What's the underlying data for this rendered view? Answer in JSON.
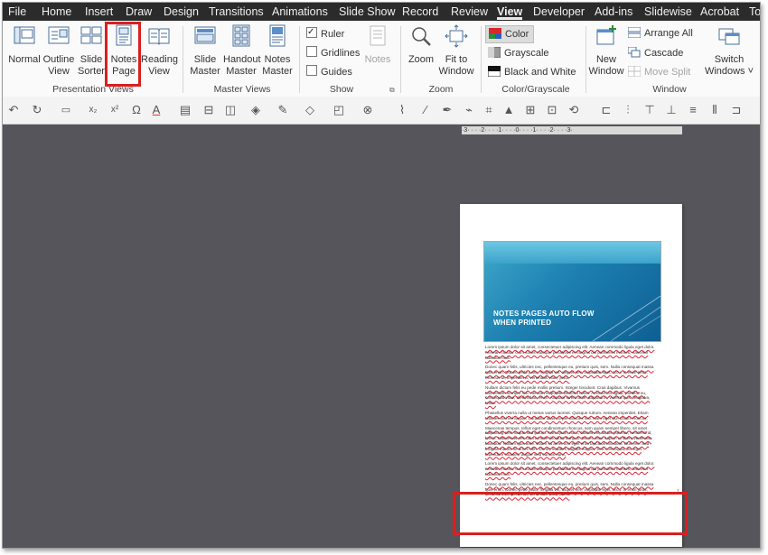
{
  "menu_tabs": [
    "File",
    "Home",
    "Insert",
    "Draw",
    "Design",
    "Transitions",
    "Animations",
    "Slide Show",
    "Record",
    "Review",
    "View",
    "Developer",
    "Add-ins",
    "Slidewise",
    "Acrobat",
    "To"
  ],
  "active_tab": "View",
  "ribbon": {
    "presentation_views": {
      "label": "Presentation Views",
      "buttons": [
        {
          "line1": "Normal",
          "line2": ""
        },
        {
          "line1": "Outline",
          "line2": "View"
        },
        {
          "line1": "Slide",
          "line2": "Sorter"
        },
        {
          "line1": "Notes",
          "line2": "Page"
        },
        {
          "line1": "Reading",
          "line2": "View"
        }
      ]
    },
    "master_views": {
      "label": "Master Views",
      "buttons": [
        {
          "line1": "Slide",
          "line2": "Master"
        },
        {
          "line1": "Handout",
          "line2": "Master"
        },
        {
          "line1": "Notes",
          "line2": "Master"
        }
      ]
    },
    "show": {
      "label": "Show",
      "ruler": "Ruler",
      "gridlines": "Gridlines",
      "guides": "Guides",
      "notes": "Notes"
    },
    "zoom": {
      "label": "Zoom",
      "zoom": "Zoom",
      "fit_line1": "Fit to",
      "fit_line2": "Window"
    },
    "color": {
      "label": "Color/Grayscale",
      "color": "Color",
      "grayscale": "Grayscale",
      "bw": "Black and White"
    },
    "window": {
      "label": "Window",
      "new_line1": "New",
      "new_line2": "Window",
      "arrange": "Arrange All",
      "cascade": "Cascade",
      "move_split": "Move Split",
      "switch_line1": "Switch",
      "switch_line2": "Windows ˅"
    }
  },
  "ruler_text": "·3·  ·  ·  ·2·  ·  ·  ·1·  ·  ·  ·0·  ·  ·  ·1·  ·  ·  ·2·  ·  ·  ·3·",
  "slide_title_line1": "NOTES PAGES AUTO FLOW",
  "slide_title_line2": "WHEN PRINTED",
  "page_number": "1",
  "notes": [
    "Lorem ipsum dolor sit amet, consectetuer adipiscing elit. Aenean commodo ligula eget dolor. Aenean massa. Cum sociis natoque penatibus et magnis dis parturient montes, nascetur ridiculus mus.",
    "Donec quam felis, ultricies nec, pellentesque eu, pretium quis, sem. Nulla consequat massa quis enim. Donec pede justo, fringilla vel, aliquet nec, vulputate eget, arcu. In enim justo, rhoncus ut, imperdiet a, venenatis vitae, justo.",
    "Nullam dictum felis eu pede mollis pretium. Integer tincidunt. Cras dapibus. Vivamus elementum semper nisi. Aenean vulputate eleifend tellus. Aenean leo ligula, porttitor eu, consequat vitae, eleifend ac, enim. Aliquam lorem ante, dapibus in, viverra quis, feugiat a, tellus.",
    "Phasellus viverra nulla ut metus varius laoreet. Quisque rutrum. Aenean imperdiet. Etiam ultricies nisi vel augue. Curabitur ullamcorper ultricies nisi. Nam eget dui. Etiam rhoncus.",
    "Maecenas tempus, tellus eget condimentum rhoncus, sem quam semper libero, sit amet adipiscing sem neque sed ipsum. Nam quam nunc, blandit vel, luctus pulvinar, hendrerit id, lorem. Maecenas nec odio et ante tincidunt tempus. Donec vitae sapien ut libero venenatis faucibus. Nullam quis ante. Etiam sit amet orci eget eros faucibus tincidunt. Duis leo. Sed fringilla mauris sit amet nibh. Donec sodales sagittis magna. Sed consequat, leo eget bibendum sodales, augue velit cursus nunc,",
    "Lorem ipsum dolor sit amet, consectetuer adipiscing elit. Aenean commodo ligula eget dolor. Aenean massa. Cum sociis natoque penatibus et magnis dis parturient montes, nascetur ridiculus mus.",
    "Donec quam felis, ultricies nec, pellentesque eu, pretium quis, sem. Nulla consequat massa quis enim. Donec pede justo, fringilla vel, aliquet nec, vulputate eget, arcu. In enim justo, rhoncus ut, imperdiet a, venenatis vitae, justo."
  ],
  "colors": {
    "highlight": "#d91f1f",
    "tabbar": "#2b2b2b",
    "canvas": "#55555b"
  }
}
